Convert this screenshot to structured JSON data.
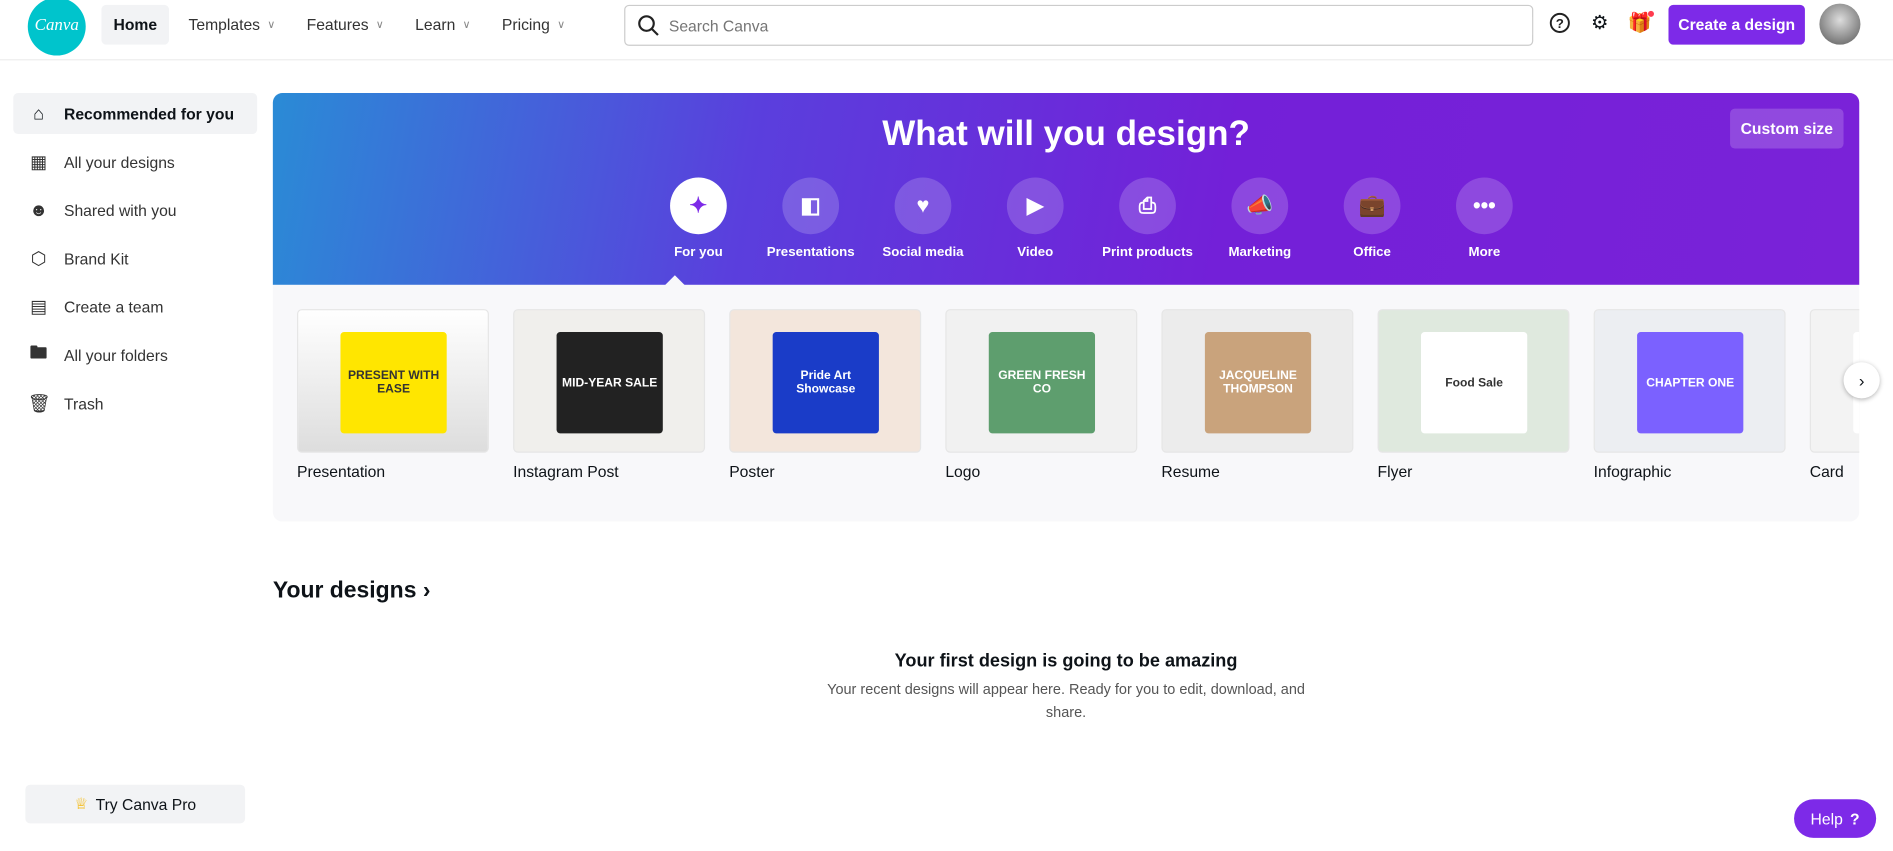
{
  "header": {
    "logo": "Canva",
    "nav": [
      {
        "label": "Home",
        "active": true
      },
      {
        "label": "Templates"
      },
      {
        "label": "Features"
      },
      {
        "label": "Learn"
      },
      {
        "label": "Pricing"
      }
    ],
    "search_placeholder": "Search Canva",
    "create_label": "Create a design",
    "icons": [
      "help-icon",
      "gear-icon",
      "gift-icon"
    ],
    "accent": "#7d2ae8"
  },
  "sidebar": {
    "items": [
      {
        "label": "Recommended for you",
        "icon": "home-icon"
      },
      {
        "label": "All your designs",
        "icon": "grid-icon"
      },
      {
        "label": "Shared with you",
        "icon": "users-icon"
      },
      {
        "label": "Brand Kit",
        "icon": "brand-icon"
      },
      {
        "label": "Create a team",
        "icon": "building-icon"
      },
      {
        "label": "All your folders",
        "icon": "folder-icon"
      },
      {
        "label": "Trash",
        "icon": "trash-icon"
      }
    ],
    "pro_label": "Try Canva Pro"
  },
  "banner": {
    "title": "What will you design?",
    "custom_size": "Custom size",
    "categories": [
      {
        "label": "For you",
        "icon": "sparkle-icon"
      },
      {
        "label": "Presentations",
        "icon": "presentation-icon"
      },
      {
        "label": "Social media",
        "icon": "heart-bubble-icon"
      },
      {
        "label": "Video",
        "icon": "video-icon"
      },
      {
        "label": "Print products",
        "icon": "printer-icon"
      },
      {
        "label": "Marketing",
        "icon": "megaphone-icon"
      },
      {
        "label": "Office",
        "icon": "briefcase-icon"
      },
      {
        "label": "More",
        "icon": "more-icon"
      }
    ]
  },
  "templates": [
    {
      "label": "Presentation",
      "thumb": "PRESENT WITH EASE"
    },
    {
      "label": "Instagram Post",
      "thumb": "MID-YEAR SALE"
    },
    {
      "label": "Poster",
      "thumb": "Pride Art Showcase"
    },
    {
      "label": "Logo",
      "thumb": "GREEN FRESH CO"
    },
    {
      "label": "Resume",
      "thumb": "JACQUELINE THOMPSON"
    },
    {
      "label": "Flyer",
      "thumb": "Food Sale"
    },
    {
      "label": "Infographic",
      "thumb": "CHAPTER ONE"
    },
    {
      "label": "Card",
      "thumb": ""
    }
  ],
  "designs": {
    "title": "Your designs",
    "empty_title": "Your first design is going to be amazing",
    "empty_text": "Your recent designs will appear here. Ready for you to edit, download, and share."
  },
  "help_label": "Help"
}
